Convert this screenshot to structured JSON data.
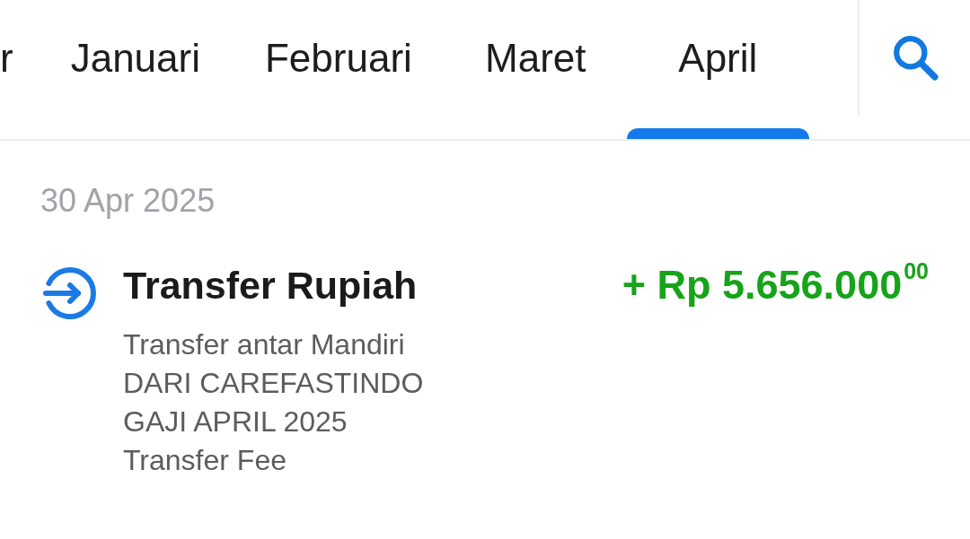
{
  "tabs": [
    {
      "label": "r",
      "selected": false
    },
    {
      "label": "Januari",
      "selected": false
    },
    {
      "label": "Februari",
      "selected": false
    },
    {
      "label": "Maret",
      "selected": false
    },
    {
      "label": "April",
      "selected": true
    }
  ],
  "days": [
    {
      "date": "30 Apr 2025",
      "transactions": [
        {
          "kind": "incoming",
          "title": "Transfer Rupiah",
          "details": [
            "Transfer antar Mandiri",
            "DARI CAREFASTINDO",
            "GAJI APRIL 2025",
            "Transfer Fee"
          ],
          "amount": "+ Rp 5.656.000$^{00}$"
        }
      ]
    }
  ]
}
